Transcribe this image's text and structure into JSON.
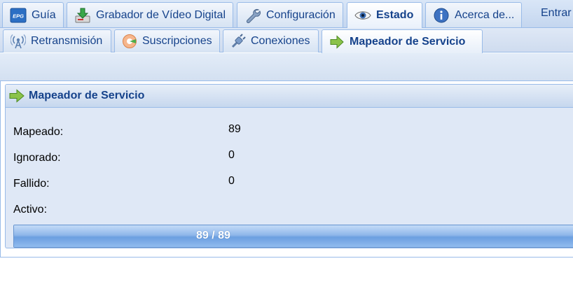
{
  "top_tabs": [
    {
      "label": "Guía",
      "icon": "epg-icon"
    },
    {
      "label": "Grabador de Vídeo Digital",
      "icon": "download-recorder-icon"
    },
    {
      "label": "Configuración",
      "icon": "wrench-icon"
    },
    {
      "label": "Estado",
      "icon": "eye-icon",
      "active": true
    },
    {
      "label": "Acerca de...",
      "icon": "info-icon"
    }
  ],
  "top_overflow_label": "Entrar",
  "epg_badge": "EPG",
  "sub_tabs": [
    {
      "label": "Retransmisión",
      "icon": "broadcast-antenna-icon"
    },
    {
      "label": "Suscripciones",
      "icon": "subscription-icon"
    },
    {
      "label": "Conexiones",
      "icon": "plug-icon"
    },
    {
      "label": "Mapeador de Servicio",
      "icon": "arrow-right-icon",
      "active": true
    }
  ],
  "panel": {
    "title": "Mapeador de Servicio",
    "fields": [
      {
        "label": "Mapeado:",
        "value": "89"
      },
      {
        "label": "Ignorado:",
        "value": "0"
      },
      {
        "label": "Fallido:",
        "value": "0"
      },
      {
        "label": "Activo:",
        "value": ""
      }
    ],
    "progress": {
      "text": "89 / 89",
      "fraction": 1.0
    }
  },
  "colors": {
    "accent_text": "#15428b",
    "border": "#99bbe8",
    "progress_fill": "#6b9fe0"
  }
}
